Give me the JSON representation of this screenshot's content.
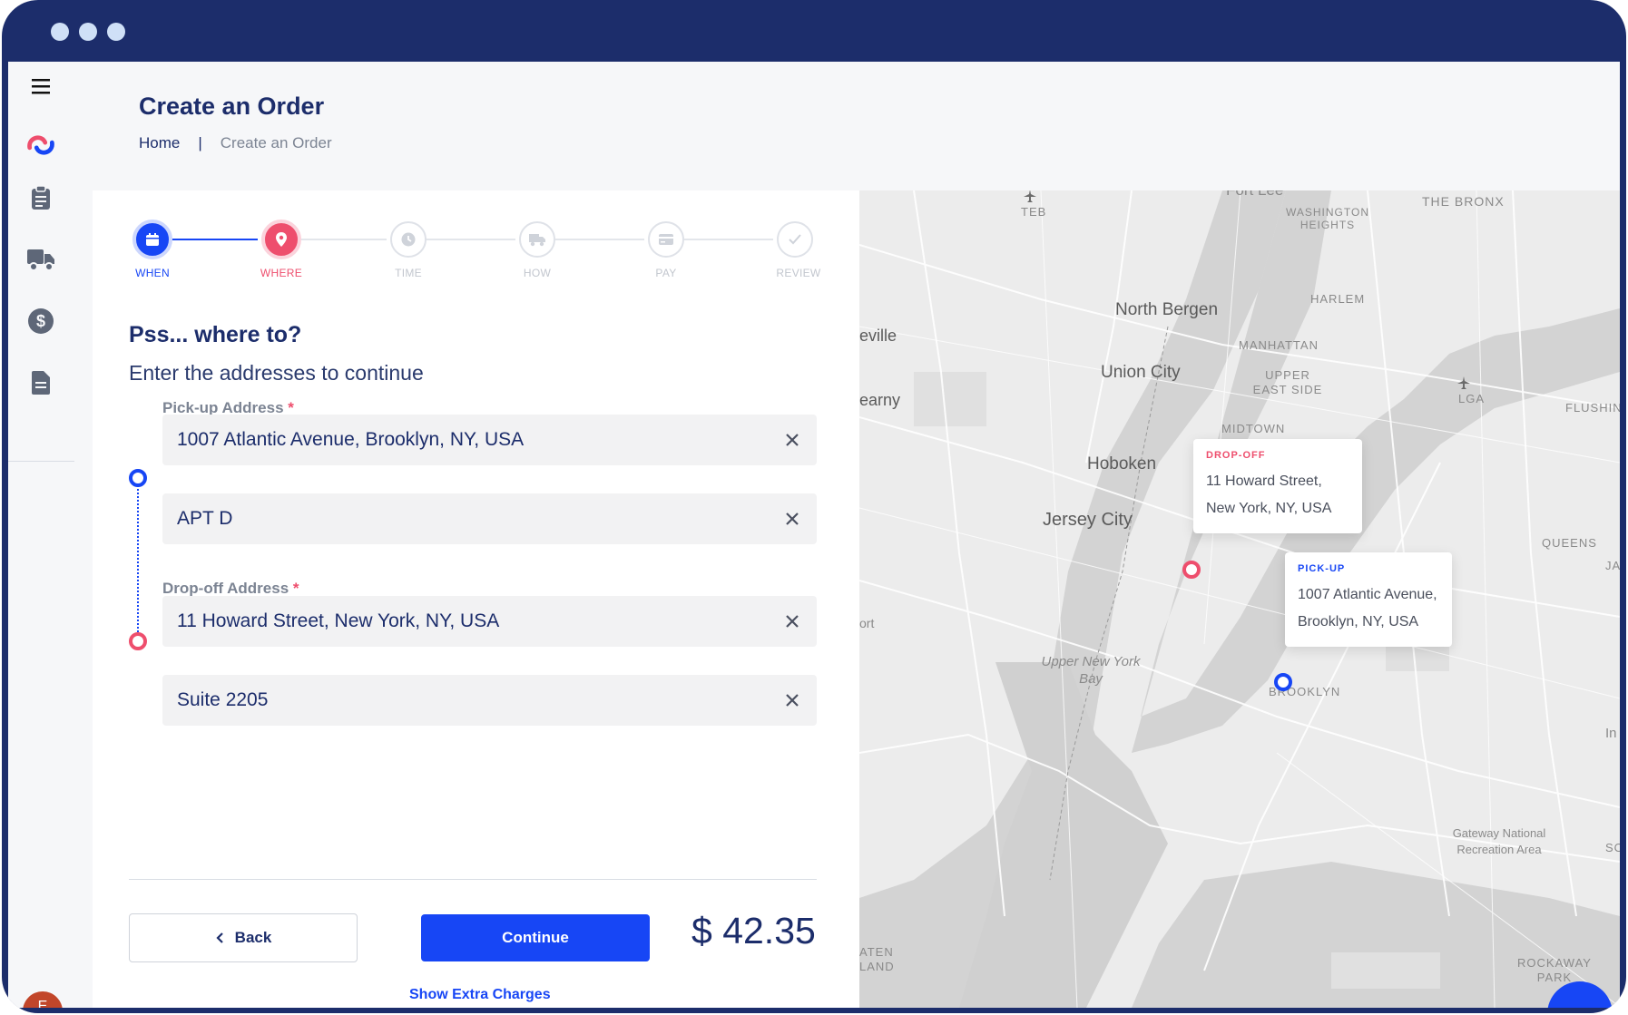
{
  "header": {
    "title": "Create an Order",
    "breadcrumb_home": "Home",
    "breadcrumb_sep": "|",
    "breadcrumb_current": "Create an Order"
  },
  "sidebar": {
    "items": [
      {
        "icon": "menu-icon"
      },
      {
        "icon": "brand-logo"
      },
      {
        "icon": "clipboard-icon"
      },
      {
        "icon": "truck-icon"
      },
      {
        "icon": "dollar-icon"
      },
      {
        "icon": "document-icon"
      }
    ],
    "avatar_initial": "E"
  },
  "stepper": {
    "steps": [
      {
        "label": "WHEN",
        "state": "done",
        "icon": "calendar-icon"
      },
      {
        "label": "WHERE",
        "state": "active",
        "icon": "location-pin-icon"
      },
      {
        "label": "TIME",
        "state": "pending",
        "icon": "clock-icon"
      },
      {
        "label": "HOW",
        "state": "pending",
        "icon": "truck-icon"
      },
      {
        "label": "PAY",
        "state": "pending",
        "icon": "card-icon"
      },
      {
        "label": "REVIEW",
        "state": "pending",
        "icon": "check-icon"
      }
    ]
  },
  "form": {
    "title": "Pss... where to?",
    "subtitle": "Enter the addresses to continue",
    "pickup_label": "Pick-up Address",
    "pickup_address": "1007 Atlantic Avenue, Brooklyn, NY, USA",
    "pickup_unit": "APT D",
    "dropoff_label": "Drop-off Address",
    "dropoff_address": "11 Howard Street, New York, NY, USA",
    "dropoff_unit": "Suite 2205",
    "required_mark": "*"
  },
  "footer": {
    "back_label": "Back",
    "continue_label": "Continue",
    "price": "$ 42.35",
    "extra_link": "Show Extra Charges"
  },
  "map": {
    "labels": {
      "fort_lee": "Fort Lee",
      "teb": "TEB",
      "bronx": "THE BRONX",
      "washington_heights": "WASHINGTON HEIGHTS",
      "harlem": "HARLEM",
      "north_bergen": "North Bergen",
      "manhattan": "MANHATTAN",
      "union_city": "Union City",
      "upper_east_side": "UPPER EAST SIDE",
      "lga": "LGA",
      "flushing": "FLUSHIN",
      "evile": "eville",
      "kearny": "earny",
      "midtown": "MIDTOWN",
      "hoboken": "Hoboken",
      "jersey_city": "Jersey City",
      "queens": "QUEENS",
      "ja": "JA",
      "ort": "ort",
      "upper_bay": "Upper New York Bay",
      "brooklyn": "BROOKLYN",
      "in": "In",
      "gateway": "Gateway National Recreation Area",
      "som": "SOM",
      "staten": "ATEN LAND",
      "rockaway": "ROCKAWAY PARK"
    },
    "dropoff_popup": {
      "tag": "DROP-OFF",
      "line1": "11 Howard Street,",
      "line2": "New York, NY, USA"
    },
    "pickup_popup": {
      "tag": "PICK-UP",
      "line1": "1007 Atlantic Avenue,",
      "line2": "Brooklyn, NY, USA"
    }
  },
  "colors": {
    "navy": "#1c2d6b",
    "blue": "#1746f5",
    "pink": "#ee4e6d",
    "frame": "#1c2d6b"
  }
}
